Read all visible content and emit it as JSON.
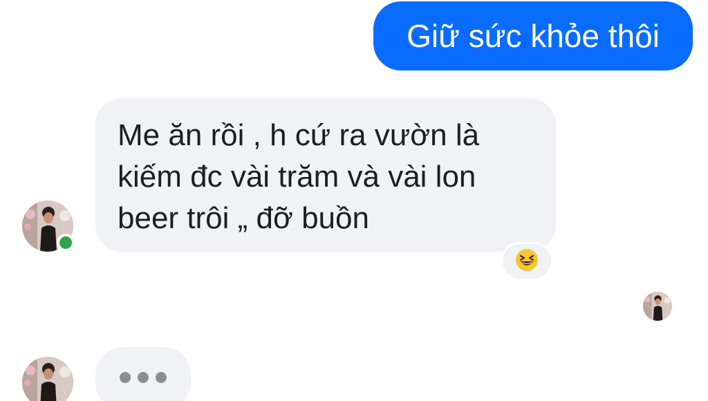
{
  "messages": {
    "sent": {
      "text": "Giữ sức khỏe thôi"
    },
    "received": {
      "lines": [
        "Me ăn rồi , h cứ ra vườn là",
        "kiếm đc vài trăm và vài lon",
        "beer trôi „ đỡ buồn"
      ],
      "reaction_icon": "laughing-emoji-icon"
    },
    "typing_indicator": {
      "dots": 3
    }
  },
  "contact": {
    "avatar_icon": "contact-avatar",
    "status": "online"
  },
  "colors": {
    "sent_bubble": "#0a6cff",
    "received_bubble": "#f1f2f6",
    "online": "#31a24c",
    "typing_dot": "#8a8d91"
  }
}
